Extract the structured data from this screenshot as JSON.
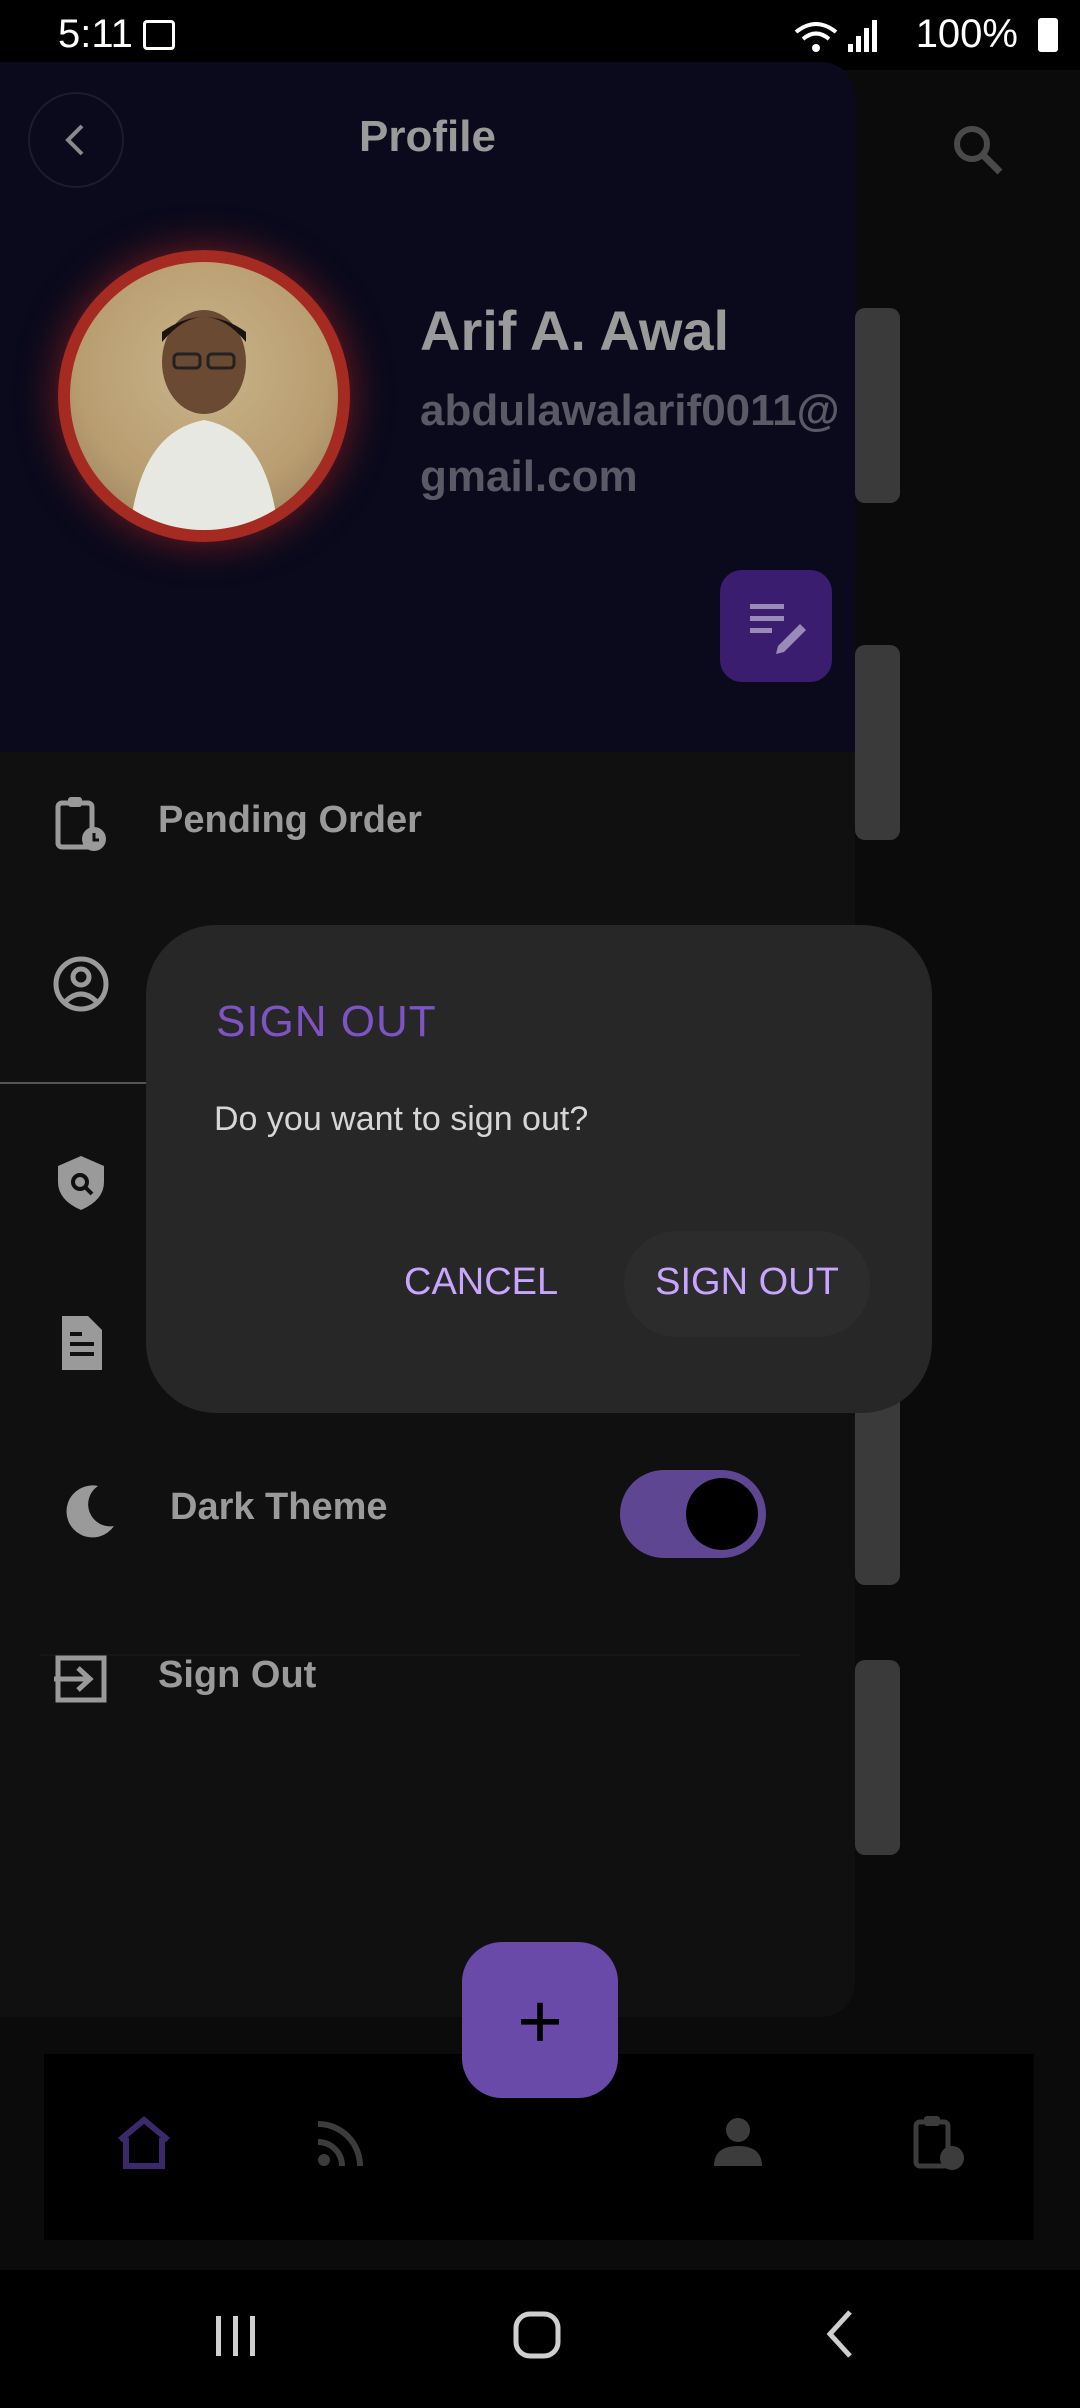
{
  "status_bar": {
    "time": "5:11",
    "battery": "100%"
  },
  "drawer": {
    "title": "Profile",
    "user_name": "Arif A. Awal",
    "user_email": "abdulawalarif0011@gmail.com",
    "menu": [
      {
        "label": "Pending Order",
        "icon": "clipboard-clock-icon"
      },
      {
        "label": "",
        "icon": "account-circle-icon"
      },
      {
        "label": "",
        "icon": "security-icon"
      },
      {
        "label": "",
        "icon": "document-icon"
      },
      {
        "label": "Dark Theme",
        "icon": "moon-icon"
      },
      {
        "label": "Sign Out",
        "icon": "logout-icon"
      }
    ],
    "dark_theme_enabled": true
  },
  "dialog": {
    "title": "SIGN OUT",
    "message": "Do you want to sign out?",
    "cancel_label": "CANCEL",
    "confirm_label": "SIGN OUT"
  },
  "fab": {
    "label": "+"
  },
  "bottom_nav": [
    "home-icon",
    "feed-icon",
    "person-icon",
    "clipboard-clock-icon"
  ],
  "colors": {
    "accent": "#7e54c5",
    "dialog_button": "#c8a5ff",
    "avatar_ring": "#a52a22"
  }
}
